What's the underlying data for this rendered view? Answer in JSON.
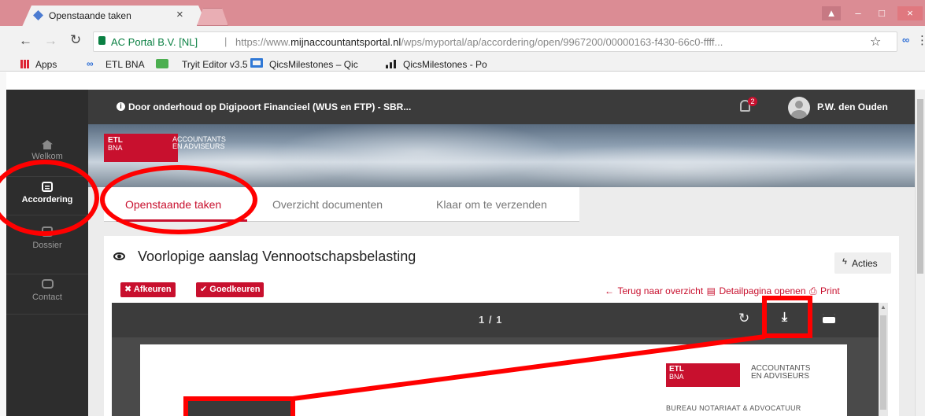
{
  "browser": {
    "tab_title": "Openstaande taken",
    "tab_close": "×",
    "site_identity": "AC Portal B.V. [NL]",
    "separator": "|",
    "url_prefix": "https://www.",
    "url_domain": "mijnaccountantsportal.nl",
    "url_path": "/wps/myportal/ap/accordering/open/9967200/00000163-f430-66c0-ffff...",
    "bookmarks": [
      {
        "label": "Apps"
      },
      {
        "label": "ETL BNA"
      },
      {
        "label": "Tryit Editor v3.5"
      },
      {
        "label": "QicsMilestones – Qic"
      },
      {
        "label": "QicsMilestones - Po"
      }
    ]
  },
  "topbar": {
    "notice": "Door onderhoud op Digipoort Financieel (WUS en FTP) - SBR...",
    "notification_count": "2",
    "user_name": "P.W. den Ouden"
  },
  "logo": {
    "brand_top": "ETL",
    "brand_bottom": "BNA",
    "tagline_1": "ACCOUNTANTS",
    "tagline_2": "EN ADVISEURS"
  },
  "sidebar": {
    "items": [
      {
        "label": "Welkom",
        "icon": "home-icon"
      },
      {
        "label": "Accordering",
        "icon": "list-icon",
        "active": true
      },
      {
        "label": "Dossier",
        "icon": "folder-icon"
      },
      {
        "label": "Contact",
        "icon": "chat-icon"
      }
    ]
  },
  "tabs": [
    {
      "label": "Openstaande taken",
      "active": true
    },
    {
      "label": "Overzicht documenten"
    },
    {
      "label": "Klaar om te verzenden"
    }
  ],
  "document": {
    "title": "Voorlopige aanslag Vennootschapsbelasting",
    "acties_label": "Acties",
    "reject_label": "Afkeuren",
    "approve_label": "Goedkeuren",
    "back_link": "Terug naar overzicht",
    "detail_link": "Detailpagina openen",
    "print_link": "Print"
  },
  "viewer": {
    "page_indicator": "1 / 1",
    "page_logo_top": "ETL",
    "page_logo_bottom": "BNA",
    "page_tagline_1": "ACCOUNTANTS",
    "page_tagline_2": "EN ADVISEURS",
    "page_subtitle": "BUREAU NOTARIAAT & ADVOCATUUR"
  },
  "colors": {
    "brand_red": "#c8102e",
    "annotation_red": "#ff0000",
    "chrome_pink": "#db8c94"
  }
}
